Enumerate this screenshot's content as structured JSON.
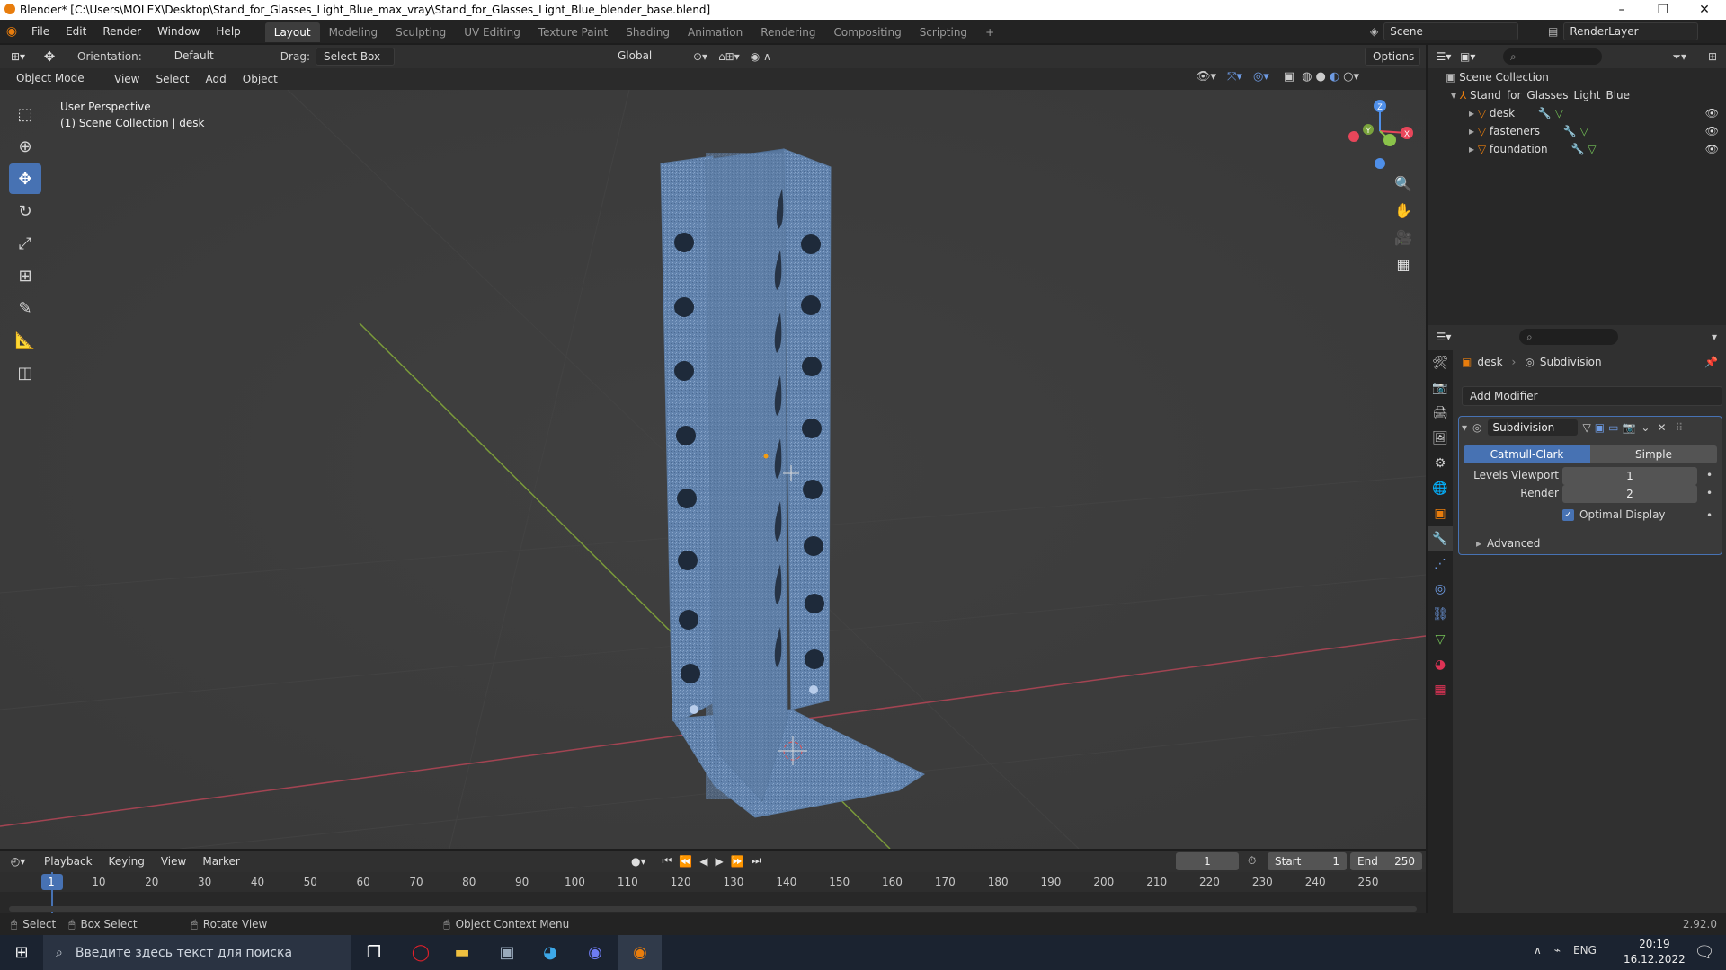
{
  "window": {
    "title": "Blender* [C:\\Users\\MOLEX\\Desktop\\Stand_for_Glasses_Light_Blue_max_vray\\Stand_for_Glasses_Light_Blue_blender_base.blend]"
  },
  "menu": [
    "File",
    "Edit",
    "Render",
    "Window",
    "Help"
  ],
  "workspaces": [
    "Layout",
    "Modeling",
    "Sculpting",
    "UV Editing",
    "Texture Paint",
    "Shading",
    "Animation",
    "Rendering",
    "Compositing",
    "Scripting",
    "+"
  ],
  "active_workspace": "Layout",
  "scene": {
    "name": "Scene",
    "view_layer": "RenderLayer"
  },
  "tool_header": {
    "orientation_label": "Orientation:",
    "orientation_value": "Default",
    "drag_label": "Drag:",
    "drag_value": "Select Box",
    "transform_orientation": "Global",
    "options": "Options"
  },
  "viewport_header": {
    "mode": "Object Mode",
    "menus": [
      "View",
      "Select",
      "Add",
      "Object"
    ]
  },
  "viewport_info": {
    "line1": "User Perspective",
    "line2": "(1) Scene Collection | desk"
  },
  "gizmo": {
    "x": "X",
    "y": "Y",
    "z": "Z"
  },
  "outliner": {
    "root": "Scene Collection",
    "collection": "Stand_for_Glasses_Light_Blue",
    "objects": [
      "desk",
      "fasteners",
      "foundation"
    ]
  },
  "properties": {
    "object": "desk",
    "modifier_context": "Subdivision",
    "add_modifier": "Add Modifier",
    "modifier_name": "Subdivision",
    "algorithm_options": [
      "Catmull-Clark",
      "Simple"
    ],
    "algorithm_selected": "Catmull-Clark",
    "levels_viewport_label": "Levels Viewport",
    "levels_viewport_value": "1",
    "render_label": "Render",
    "render_value": "2",
    "optimal_display_label": "Optimal Display",
    "optimal_display_checked": true,
    "advanced_label": "Advanced"
  },
  "timeline": {
    "menus": [
      "Playback",
      "Keying",
      "View",
      "Marker"
    ],
    "current_frame": "1",
    "start_label": "Start",
    "start_value": "1",
    "end_label": "End",
    "end_value": "250",
    "ruler": [
      "1",
      "10",
      "20",
      "30",
      "40",
      "50",
      "60",
      "70",
      "80",
      "90",
      "100",
      "110",
      "120",
      "130",
      "140",
      "150",
      "160",
      "170",
      "180",
      "190",
      "200",
      "210",
      "220",
      "230",
      "240",
      "250"
    ]
  },
  "statusbar": {
    "select": "Select",
    "box_select": "Box Select",
    "rotate_view": "Rotate View",
    "context_menu": "Object Context Menu",
    "version": "2.92.0"
  },
  "taskbar": {
    "search_placeholder": "Введите здесь текст для поиска",
    "language": "ENG",
    "time": "20:19",
    "date": "16.12.2022"
  },
  "colors": {
    "accent": "#4772b3",
    "x_axis": "#e8465a",
    "y_axis": "#8bc34a",
    "z_axis": "#4f8fe8",
    "object_orange": "#e87d0d",
    "mesh_blue": "#6d8fb8"
  }
}
